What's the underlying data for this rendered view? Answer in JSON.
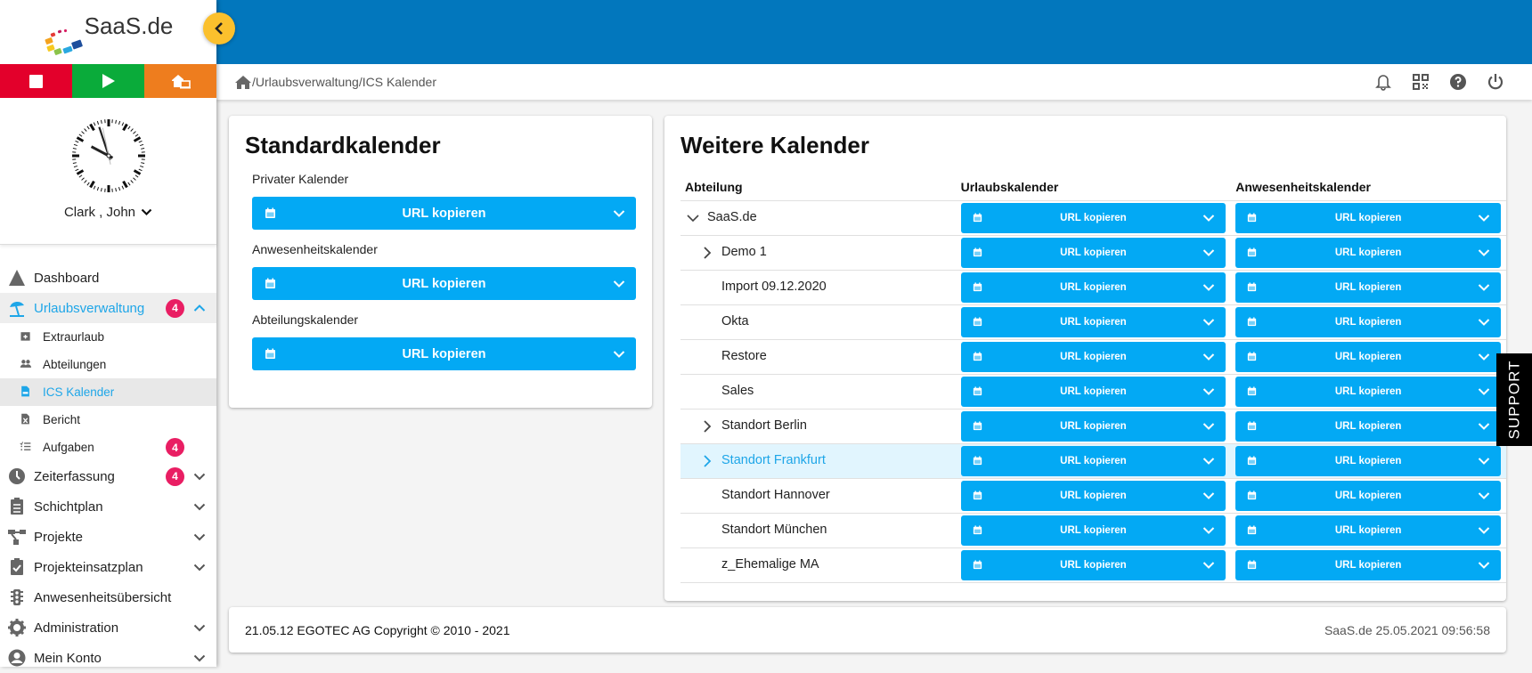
{
  "brand": {
    "name": "SaaS.de"
  },
  "controls": {
    "stop": "stop-icon",
    "play": "play-icon",
    "home_office": "home-office-icon"
  },
  "clock": {
    "time": "09:56:58"
  },
  "user": {
    "name": "Clark , John"
  },
  "sidebar": {
    "items": [
      {
        "label": "Dashboard",
        "icon": "camp-icon"
      },
      {
        "label": "Urlaubsverwaltung",
        "icon": "beach-umbrella-icon",
        "badge": "4",
        "state": "open"
      },
      {
        "label": "Extraurlaub",
        "icon": "calendar-plus-icon",
        "sub": true
      },
      {
        "label": "Abteilungen",
        "icon": "users-icon",
        "sub": true
      },
      {
        "label": "ICS Kalender",
        "icon": "csv-file-icon",
        "sub": true,
        "state": "active"
      },
      {
        "label": "Bericht",
        "icon": "excel-file-icon",
        "sub": true
      },
      {
        "label": "Aufgaben",
        "icon": "tasks-icon",
        "sub": true,
        "badge": "4"
      },
      {
        "label": "Zeiterfassung",
        "icon": "clock-icon",
        "badge": "4"
      },
      {
        "label": "Schichtplan",
        "icon": "clipboard-list-icon"
      },
      {
        "label": "Projekte",
        "icon": "sitemap-icon"
      },
      {
        "label": "Projekteinsatzplan",
        "icon": "clipboard-check-icon"
      },
      {
        "label": "Anwesenheitsübersicht",
        "icon": "traffic-light-icon"
      },
      {
        "label": "Administration",
        "icon": "gear-icon"
      },
      {
        "label": "Mein Konto",
        "icon": "user-circle-icon"
      }
    ]
  },
  "breadcrumb": {
    "path": "/Urlaubsverwaltung/ICS Kalender"
  },
  "standard": {
    "title": "Standardkalender",
    "sections": [
      {
        "label": "Privater Kalender",
        "button": "URL kopieren"
      },
      {
        "label": "Anwesenheitskalender",
        "button": "URL kopieren"
      },
      {
        "label": "Abteilungskalender",
        "button": "URL kopieren"
      }
    ]
  },
  "weitere": {
    "title": "Weitere Kalender",
    "columns": [
      "Abteilung",
      "Urlaubskalender",
      "Anwesenheitskalender"
    ],
    "button_label": "URL kopieren",
    "rows": [
      {
        "name": "SaaS.de",
        "expander": "expanded",
        "level": 0
      },
      {
        "name": "Demo 1",
        "expander": "collapsed",
        "level": 1
      },
      {
        "name": "Import 09.12.2020",
        "expander": "none",
        "level": 1
      },
      {
        "name": "Okta",
        "expander": "none",
        "level": 1
      },
      {
        "name": "Restore",
        "expander": "none",
        "level": 1
      },
      {
        "name": "Sales",
        "expander": "none",
        "level": 1
      },
      {
        "name": "Standort Berlin",
        "expander": "collapsed",
        "level": 1
      },
      {
        "name": "Standort Frankfurt",
        "expander": "collapsed",
        "level": 1,
        "highlighted": true
      },
      {
        "name": "Standort Hannover",
        "expander": "none",
        "level": 1
      },
      {
        "name": "Standort München",
        "expander": "none",
        "level": 1
      },
      {
        "name": "z_Ehemalige MA",
        "expander": "none",
        "level": 1
      }
    ]
  },
  "support": {
    "label": "SUPPORT"
  },
  "footer": {
    "copyright": "21.05.12 EGOTEC AG Copyright © 2010 - 2021",
    "right": "SaaS.de  25.05.2021 09:56:58"
  },
  "colors": {
    "primary": "#03a9f4",
    "header": "#0277bd",
    "accent_text": "#1ea6e8",
    "badge": "#e91e63",
    "toggle": "#fbc02d",
    "stop": "#e3002b",
    "play": "#0aab3a",
    "home": "#ee7d1e"
  }
}
